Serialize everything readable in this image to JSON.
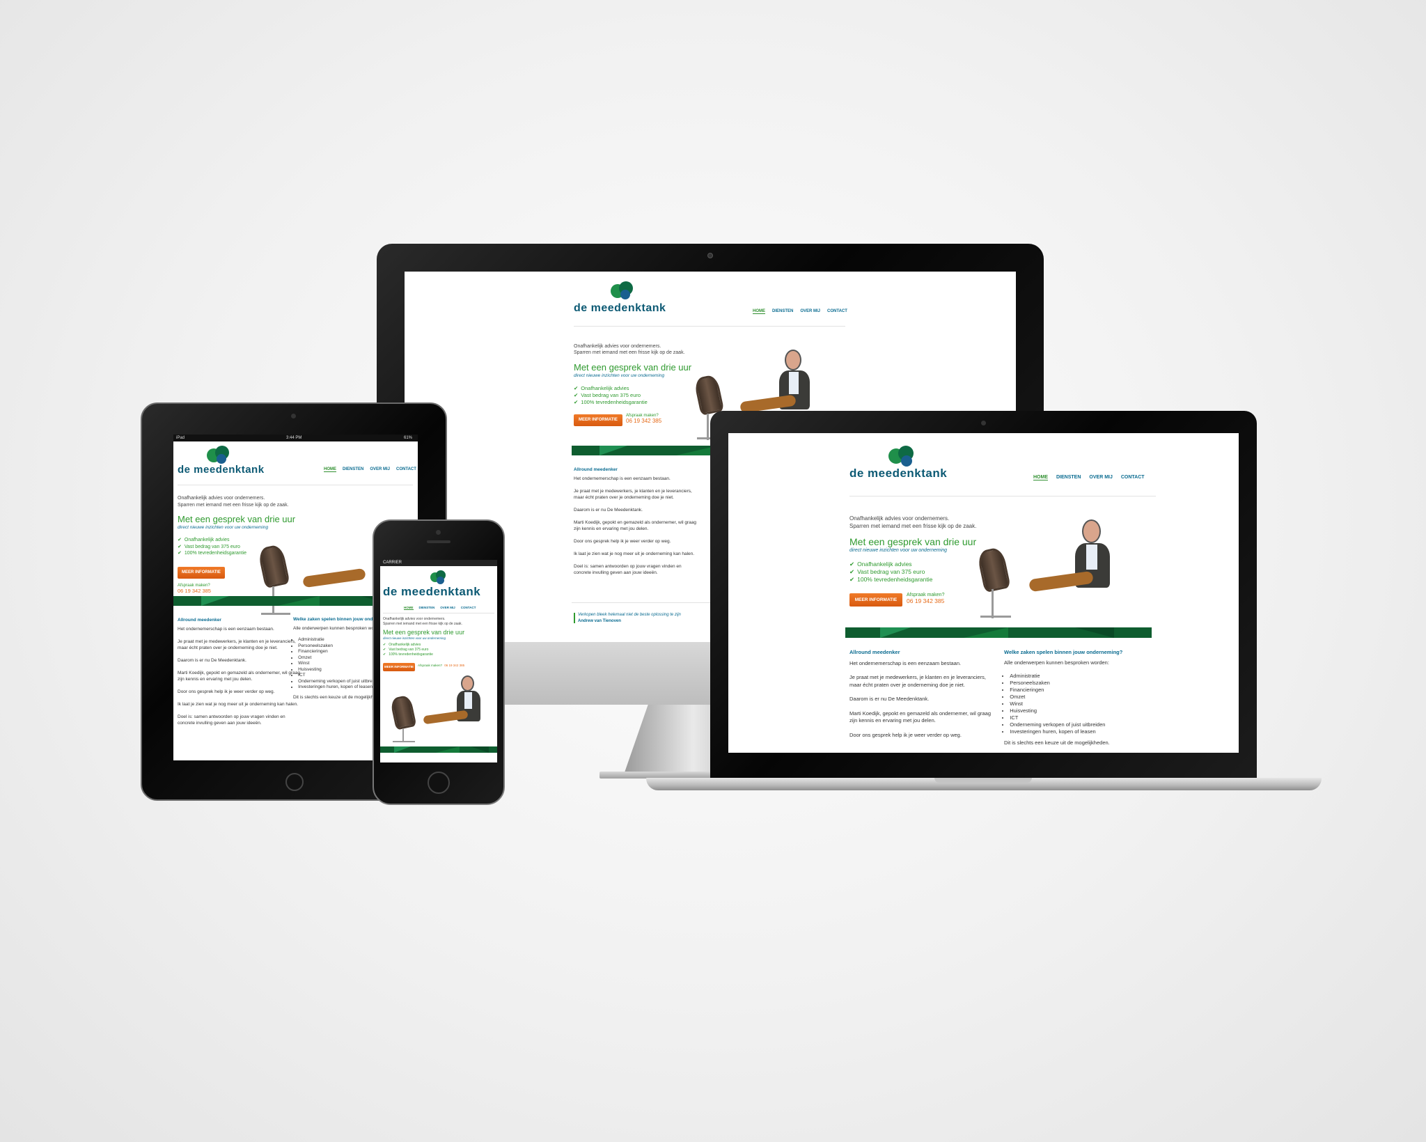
{
  "site": {
    "logo_text": "de meedenktank",
    "nav": [
      "HOME",
      "DIENSTEN",
      "OVER MIJ",
      "CONTACT"
    ],
    "tagline_1": "Onafhankelijk advies voor ondernemers.",
    "tagline_2": "Sparren met iemand met een frisse kijk op de zaak.",
    "headline": "Met een gesprek van drie uur",
    "subheadline": "direct nieuwe inzichten voor uw onderneming",
    "checks": [
      "Onafhankelijk advies",
      "Vast bedrag van 375 euro",
      "100% tevredenheidsgarantie"
    ],
    "cta_label": "MEER INFORMATIE",
    "appointment_label": "Afspraak maken?",
    "phone": "06 19 342 385",
    "col1_title": "Allround meedenker",
    "col1_paragraphs": [
      "Het ondernemerschap is een eenzaam bestaan.",
      "Je praat met je medewerkers, je klanten en je leveranciers,",
      "maar écht praten over je onderneming doe je niet.",
      "Daarom is er nu De Meedenktank.",
      "Marti Koedijk, gepokt en gemazeld als ondernemer, wil graag",
      "zijn kennis en ervaring met jou delen.",
      "Door ons gesprek help ik je weer verder op weg.",
      "Ik laat je zien wat je nog meer uit je onderneming kan halen.",
      "Doel is: samen antwoorden op jouw vragen vinden en",
      "concrete invulling geven aan jouw ideeën."
    ],
    "col2_title": "Welke zaken spelen binnen jouw onderneming?",
    "col2_intro": "Alle onderwerpen kunnen besproken worden:",
    "col2_items": [
      "Administratie",
      "Personeelszaken",
      "Financieringen",
      "Omzet",
      "Winst",
      "Huisvesting",
      "ICT",
      "Onderneming verkopen of juist uitbreiden",
      "Investeringen huren, kopen of leasen"
    ],
    "col2_outro": "Dit is slechts een keuze uit de mogelijkheden.",
    "quote": "Verkopen bleek helemaal niet de beste oplossing te zijn",
    "quote_author": "Andrew van Tienoven"
  },
  "ipad_status": {
    "left": "iPad",
    "time": "3:44 PM",
    "right": "61%"
  },
  "iphone_status": {
    "carrier": "CARRIER"
  },
  "colors": {
    "brand_green": "#2f9a2f",
    "brand_blue": "#0b6c91",
    "cta_orange": "#e56a18",
    "band_green": "#0e5d2f"
  }
}
